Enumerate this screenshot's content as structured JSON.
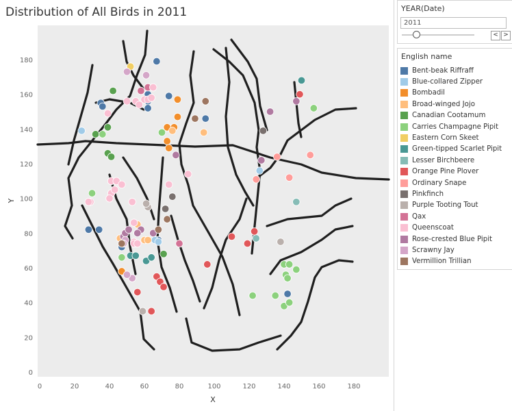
{
  "title": "Distribution of All Birds in 2011",
  "filter": {
    "title": "YEAR(Date)",
    "value": "2011",
    "prev": "<",
    "next": ">"
  },
  "legend": {
    "title": "English name",
    "items": [
      {
        "label": "Bent-beak Riffraff",
        "color": "#4e79a7"
      },
      {
        "label": "Blue-collared Zipper",
        "color": "#a0cbe8"
      },
      {
        "label": "Bombadil",
        "color": "#f28e2b"
      },
      {
        "label": "Broad-winged Jojo",
        "color": "#ffbe7d"
      },
      {
        "label": "Canadian Cootamum",
        "color": "#59a14f"
      },
      {
        "label": "Carries Champagne Pipit",
        "color": "#8cd17d"
      },
      {
        "label": "Eastern Corn Skeet",
        "color": "#f1ce63"
      },
      {
        "label": "Green-tipped Scarlet Pipit",
        "color": "#499894"
      },
      {
        "label": "Lesser Birchbeere",
        "color": "#86bcb6"
      },
      {
        "label": "Orange Pine Plover",
        "color": "#e15759"
      },
      {
        "label": "Ordinary Snape",
        "color": "#ff9d9a"
      },
      {
        "label": "Pinkfinch",
        "color": "#79706e"
      },
      {
        "label": "Purple Tooting Tout",
        "color": "#bab0ac"
      },
      {
        "label": "Qax",
        "color": "#d37295"
      },
      {
        "label": "Queenscoat",
        "color": "#fabfd2"
      },
      {
        "label": "Rose-crested Blue Pipit",
        "color": "#b07aa1"
      },
      {
        "label": "Scrawny Jay",
        "color": "#d4a6c8"
      },
      {
        "label": "Vermillion Trillian",
        "color": "#9d7660"
      }
    ]
  },
  "chart_data": {
    "type": "scatter",
    "title": "Distribution of All Birds in 2011",
    "xlabel": "X",
    "ylabel": "Y",
    "xlim": [
      0,
      200
    ],
    "ylim": [
      0,
      200
    ],
    "xticks": [
      "0",
      "20",
      "40",
      "60",
      "80",
      "100",
      "120",
      "140",
      "160",
      "180"
    ],
    "yticks": [
      "0",
      "20",
      "40",
      "60",
      "80",
      "100",
      "120",
      "140",
      "160",
      "180"
    ],
    "series": [
      {
        "name": "Bent-beak Riffraff",
        "color": "#4e79a7",
        "points": [
          [
            67,
            179
          ],
          [
            35,
            155
          ],
          [
            36,
            153
          ],
          [
            62,
            160
          ],
          [
            62,
            156
          ],
          [
            62,
            152
          ],
          [
            74,
            159
          ],
          [
            95,
            146
          ],
          [
            28,
            82
          ],
          [
            34,
            82
          ],
          [
            47,
            72
          ],
          [
            68,
            76
          ],
          [
            142,
            45
          ]
        ]
      },
      {
        "name": "Blue-collared Zipper",
        "color": "#a0cbe8",
        "points": [
          [
            24,
            139
          ],
          [
            126,
            116
          ],
          [
            66,
            76
          ],
          [
            68,
            75
          ]
        ]
      },
      {
        "name": "Bombadil",
        "color": "#f28e2b",
        "points": [
          [
            73,
            141
          ],
          [
            77,
            141
          ],
          [
            79,
            147
          ],
          [
            73,
            133
          ],
          [
            74,
            129
          ],
          [
            79,
            157
          ],
          [
            47,
            58
          ]
        ]
      },
      {
        "name": "Broad-winged Jojo",
        "color": "#ffbe7d",
        "points": [
          [
            76,
            139
          ],
          [
            94,
            138
          ],
          [
            46,
            77
          ],
          [
            56,
            85
          ],
          [
            60,
            76
          ],
          [
            62,
            76
          ]
        ]
      },
      {
        "name": "Canadian Cootamum",
        "color": "#59a14f",
        "points": [
          [
            42,
            162
          ],
          [
            39,
            141
          ],
          [
            32,
            137
          ],
          [
            39,
            126
          ],
          [
            41,
            124
          ],
          [
            71,
            68
          ]
        ]
      },
      {
        "name": "Carries Champagne Pipit",
        "color": "#8cd17d",
        "points": [
          [
            157,
            152
          ],
          [
            30,
            103
          ],
          [
            36,
            137
          ],
          [
            70,
            138
          ],
          [
            47,
            66
          ],
          [
            122,
            44
          ],
          [
            135,
            44
          ],
          [
            140,
            62
          ],
          [
            143,
            62
          ],
          [
            147,
            59
          ],
          [
            141,
            56
          ],
          [
            142,
            54
          ],
          [
            140,
            38
          ],
          [
            143,
            40
          ]
        ]
      },
      {
        "name": "Eastern Corn Skeet",
        "color": "#f1ce63",
        "points": [
          [
            52,
            176
          ]
        ]
      },
      {
        "name": "Green-tipped Scarlet Pipit",
        "color": "#499894",
        "points": [
          [
            150,
            168
          ],
          [
            52,
            67
          ],
          [
            55,
            67
          ],
          [
            61,
            64
          ],
          [
            64,
            66
          ]
        ]
      },
      {
        "name": "Lesser Birchbeere",
        "color": "#86bcb6",
        "points": [
          [
            147,
            98
          ],
          [
            124,
            77
          ]
        ]
      },
      {
        "name": "Orange Pine Plover",
        "color": "#e15759",
        "points": [
          [
            149,
            160
          ],
          [
            110,
            78
          ],
          [
            119,
            74
          ],
          [
            123,
            81
          ],
          [
            96,
            62
          ],
          [
            67,
            55
          ],
          [
            69,
            52
          ],
          [
            71,
            49
          ],
          [
            56,
            46
          ],
          [
            64,
            35
          ]
        ]
      },
      {
        "name": "Ordinary Snape",
        "color": "#ff9d9a",
        "points": [
          [
            136,
            124
          ],
          [
            143,
            112
          ],
          [
            155,
            125
          ],
          [
            124,
            111
          ]
        ]
      },
      {
        "name": "Pinkfinch",
        "color": "#79706e",
        "points": [
          [
            128,
            139
          ],
          [
            76,
            101
          ],
          [
            72,
            94
          ]
        ]
      },
      {
        "name": "Purple Tooting Tout",
        "color": "#bab0ac",
        "points": [
          [
            62,
            95
          ],
          [
            61,
            97
          ],
          [
            138,
            75
          ],
          [
            59,
            35
          ]
        ]
      },
      {
        "name": "Qax",
        "color": "#d37295",
        "points": [
          [
            58,
            162
          ],
          [
            62,
            164
          ],
          [
            80,
            74
          ]
        ]
      },
      {
        "name": "Queenscoat",
        "color": "#fabfd2",
        "points": [
          [
            39,
            149
          ],
          [
            55,
            156
          ],
          [
            57,
            154
          ],
          [
            60,
            157
          ],
          [
            62,
            157
          ],
          [
            64,
            158
          ],
          [
            41,
            110
          ],
          [
            44,
            110
          ],
          [
            47,
            108
          ],
          [
            41,
            103
          ],
          [
            43,
            105
          ],
          [
            40,
            100
          ],
          [
            29,
            98
          ],
          [
            28,
            98
          ],
          [
            53,
            98
          ],
          [
            54,
            86
          ],
          [
            74,
            108
          ],
          [
            85,
            114
          ],
          [
            54,
            75
          ],
          [
            54,
            74
          ],
          [
            56,
            74
          ],
          [
            65,
            164
          ],
          [
            50,
            156
          ]
        ]
      },
      {
        "name": "Rose-crested Blue Pipit",
        "color": "#b07aa1",
        "points": [
          [
            132,
            150
          ],
          [
            127,
            122
          ],
          [
            58,
            82
          ],
          [
            48,
            78
          ],
          [
            49,
            80
          ],
          [
            51,
            82
          ],
          [
            65,
            80
          ],
          [
            56,
            80
          ],
          [
            78,
            125
          ],
          [
            147,
            156
          ]
        ]
      },
      {
        "name": "Scrawny Jay",
        "color": "#d4a6c8",
        "points": [
          [
            61,
            171
          ],
          [
            49,
            76
          ],
          [
            48,
            74
          ],
          [
            53,
            54
          ],
          [
            50,
            56
          ],
          [
            50,
            173
          ]
        ]
      },
      {
        "name": "Vermillion Trillian",
        "color": "#9d7660",
        "points": [
          [
            95,
            156
          ],
          [
            89,
            146
          ],
          [
            73,
            88
          ],
          [
            68,
            82
          ],
          [
            47,
            74
          ]
        ]
      }
    ],
    "grid": false,
    "legend_position": "right"
  }
}
